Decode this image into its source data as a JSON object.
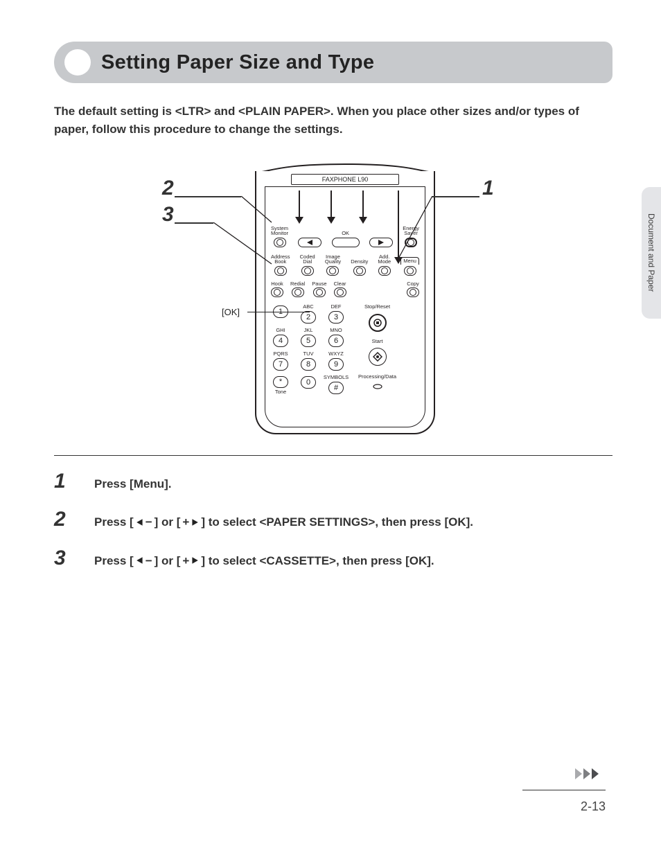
{
  "heading": "Setting Paper Size and Type",
  "intro": "The default setting is <LTR> and <PLAIN PAPER>. When you place other sizes and/or types of paper, follow this procedure to change the settings.",
  "side_tab": "Document and Paper",
  "page_number": "2-13",
  "diagram": {
    "model": "FAXPHONE L90",
    "ok_label": "[OK]",
    "callouts": {
      "left_top": "2",
      "left_bottom": "3",
      "right": "1"
    },
    "row1": {
      "system_monitor": "System\nMonitor",
      "minus": "−",
      "ok": "OK",
      "plus": "+",
      "energy": "Energy\nSaver"
    },
    "row2": {
      "labels": [
        "Address\nBook",
        "Coded\nDial",
        "Image\nQuality",
        "Density",
        "Add.\nMode",
        "Menu"
      ]
    },
    "row3": {
      "labels": [
        "Hook",
        "Redial",
        "Pause",
        "Clear",
        "Copy"
      ]
    },
    "keypad": {
      "letters": [
        "",
        "ABC",
        "DEF",
        "GHI",
        "JKL",
        "MNO",
        "PQRS",
        "TUV",
        "WXYZ",
        "",
        "",
        "SYMBOLS"
      ],
      "keys": [
        "1",
        "2",
        "3",
        "4",
        "5",
        "6",
        "7",
        "8",
        "9",
        "*",
        "0",
        "#"
      ],
      "tone": "Tone"
    },
    "right_col": {
      "stop": "Stop/Reset",
      "start": "Start",
      "processing": "Processing/Data"
    }
  },
  "steps": [
    {
      "num": "1",
      "pre": "Press [Menu].",
      "mid": "",
      "post": ""
    },
    {
      "num": "2",
      "pre": "Press [",
      "mid": "] or [",
      "post": "] to select <PAPER SETTINGS>, then press [OK]."
    },
    {
      "num": "3",
      "pre": "Press [",
      "mid": "] or [",
      "post": "] to select <CASSETTE>, then press [OK]."
    }
  ]
}
